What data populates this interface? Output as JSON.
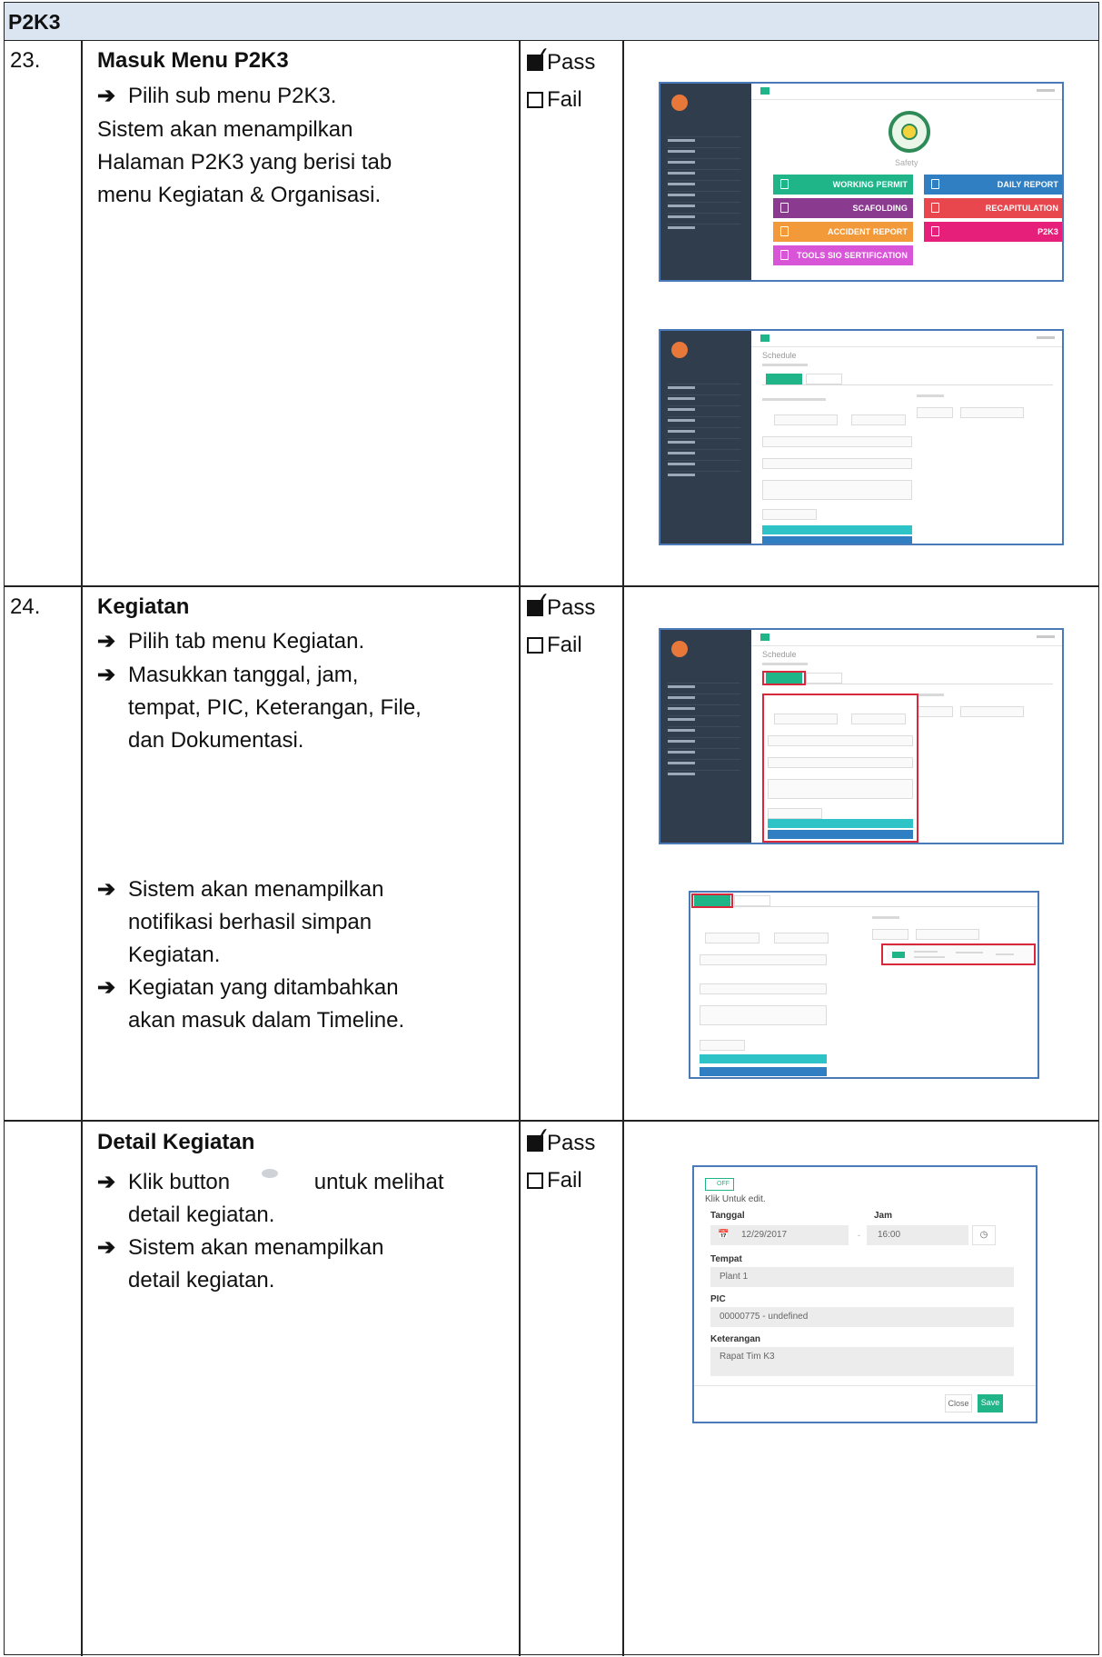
{
  "section": {
    "title": "P2K3"
  },
  "rows": [
    {
      "no": "23.",
      "title": "Masuk Menu P2K3",
      "lines": [
        "Pilih sub menu P2K3.",
        "Sistem akan menampilkan",
        "Halaman P2K3 yang berisi tab",
        "menu Kegiatan & Organisasi."
      ],
      "pass": "Pass",
      "fail": "Fail"
    },
    {
      "no": "24.",
      "title": "Kegiatan",
      "lines_a": [
        "Pilih tab menu Kegiatan.",
        "Masukkan tanggal, jam,",
        "tempat, PIC, Keterangan, File,",
        "dan Dokumentasi."
      ],
      "lines_b": [
        "Sistem akan menampilkan",
        "notifikasi berhasil simpan",
        "Kegiatan.",
        "Kegiatan yang ditambahkan",
        "akan masuk dalam Timeline."
      ],
      "pass": "Pass",
      "fail": "Fail"
    },
    {
      "no": "",
      "title": "Detail Kegiatan",
      "line_1a": "Klik button",
      "line_1b": "untuk melihat",
      "line_2": "detail kegiatan.",
      "line_3": "Sistem akan menampilkan",
      "line_4": "detail kegiatan.",
      "pass": "Pass",
      "fail": "Fail"
    }
  ],
  "dashboard": {
    "caption": "Safety",
    "tiles": [
      {
        "label": "WORKING PERMIT",
        "color": "#1fb589"
      },
      {
        "label": "DAILY REPORT",
        "color": "#2f7fc2"
      },
      {
        "label": "SCAFOLDING",
        "color": "#8a3a8f"
      },
      {
        "label": "RECAPITULATION",
        "color": "#e8474e"
      },
      {
        "label": "ACCIDENT REPORT",
        "color": "#f29a3a"
      },
      {
        "label": "P2K3",
        "color": "#e61f7a"
      },
      {
        "label": "TOOLS SIO SERTIFICATION",
        "color": "#d855d8"
      }
    ]
  },
  "schedule": {
    "title": "Schedule"
  },
  "detail_modal": {
    "toggle": "OFF",
    "hint": "Klik Untuk edit.",
    "tanggal_label": "Tanggal",
    "tanggal_value": "12/29/2017",
    "jam_label": "Jam",
    "jam_value": "16:00",
    "tempat_label": "Tempat",
    "tempat_value": "Plant 1",
    "pic_label": "PIC",
    "pic_value": "00000775 - undefined",
    "keterangan_label": "Keterangan",
    "keterangan_value": "Rapat Tim K3",
    "close_label": "Close",
    "save_label": "Save"
  },
  "icons": [
    "arrow-right-icon",
    "checked-box-icon",
    "unchecked-box-icon",
    "eye-icon",
    "calendar-icon",
    "clock-icon"
  ]
}
